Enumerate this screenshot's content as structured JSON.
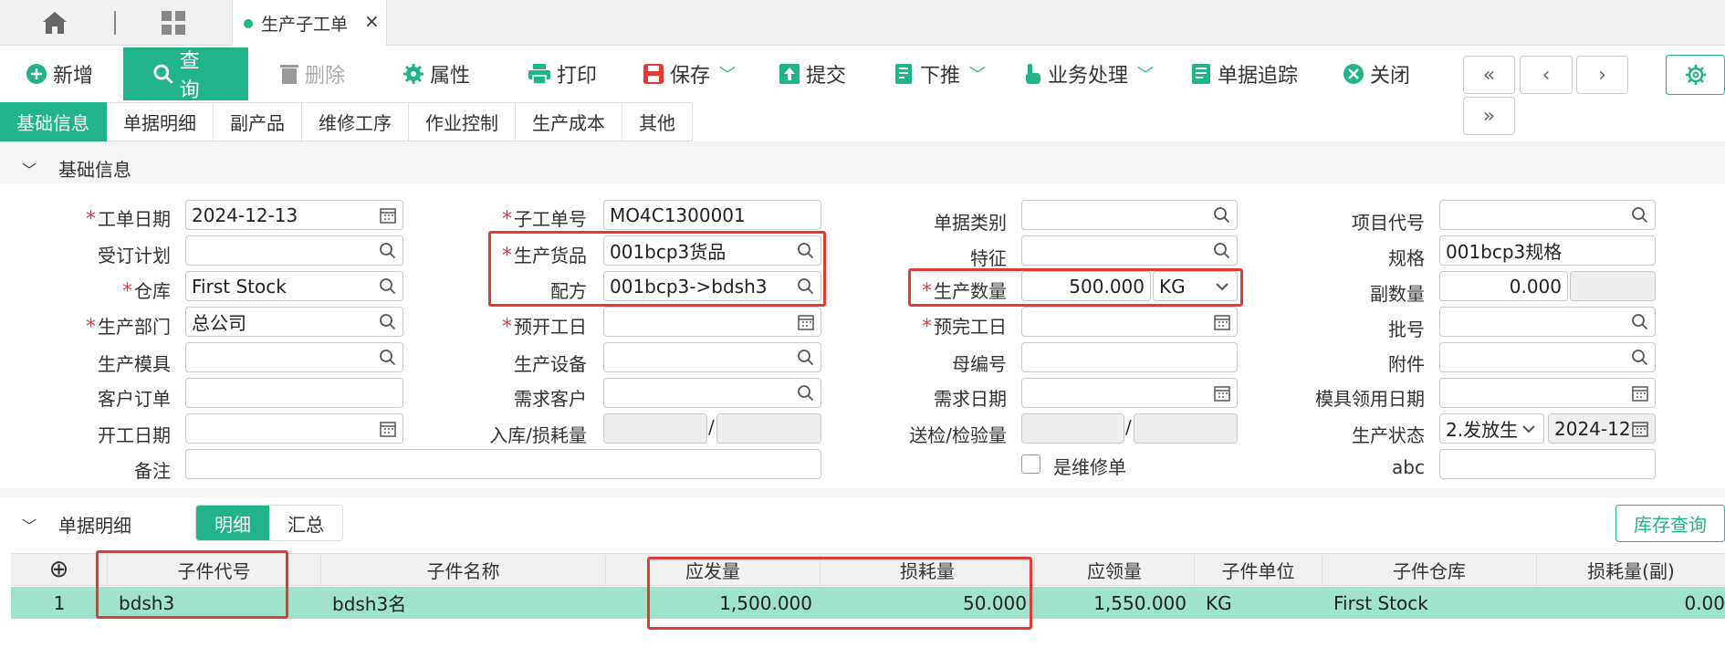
{
  "tabbar": {
    "active_tab": "生产子工单",
    "close": "×"
  },
  "toolbar": {
    "new": "新增",
    "query": "查询",
    "delete": "删除",
    "props": "属性",
    "print": "打印",
    "save": "保存",
    "submit": "提交",
    "push": "下推",
    "business": "业务处理",
    "trace": "单据追踪",
    "close": "关闭",
    "nav": [
      "«",
      "‹",
      "›",
      "»"
    ]
  },
  "section_tabs": [
    "基础信息",
    "单据明细",
    "副产品",
    "维修工序",
    "作业控制",
    "生产成本",
    "其他"
  ],
  "basic_section_title": "基础信息",
  "form": {
    "work_date": {
      "label": "工单日期",
      "value": "2024-12-13"
    },
    "order_plan": {
      "label": "受订计划",
      "value": ""
    },
    "warehouse": {
      "label": "仓库",
      "value": "First Stock"
    },
    "dept": {
      "label": "生产部门",
      "value": "总公司"
    },
    "mold": {
      "label": "生产模具",
      "value": ""
    },
    "cust_order": {
      "label": "客户订单",
      "value": ""
    },
    "open_date": {
      "label": "开工日期",
      "value": ""
    },
    "remark": {
      "label": "备注",
      "value": ""
    },
    "sub_no": {
      "label": "子工单号",
      "value": "MO4C1300001"
    },
    "goods": {
      "label": "生产货品",
      "value": "001bcp3货品"
    },
    "recipe": {
      "label": "配方",
      "value": "001bcp3->bdsh3"
    },
    "plan_open": {
      "label": "预开工日",
      "value": ""
    },
    "equip": {
      "label": "生产设备",
      "value": ""
    },
    "demand_cust": {
      "label": "需求客户",
      "value": ""
    },
    "in_loss": {
      "label": "入库/损耗量",
      "sep": "/"
    },
    "doc_type": {
      "label": "单据类别",
      "value": ""
    },
    "feature": {
      "label": "特征",
      "value": ""
    },
    "qty": {
      "label": "生产数量",
      "value": "500.000",
      "unit": "KG"
    },
    "plan_done": {
      "label": "预完工日",
      "value": ""
    },
    "parent_no": {
      "label": "母编号",
      "value": ""
    },
    "demand_date": {
      "label": "需求日期",
      "value": ""
    },
    "inspect": {
      "label": "送检/检验量",
      "sep": "/"
    },
    "repair": {
      "label": "是维修单"
    },
    "project": {
      "label": "项目代号",
      "value": ""
    },
    "spec": {
      "label": "规格",
      "value": "001bcp3规格"
    },
    "sub_qty": {
      "label": "副数量",
      "value": "0.000"
    },
    "batch": {
      "label": "批号",
      "value": ""
    },
    "attach": {
      "label": "附件",
      "value": ""
    },
    "mold_date": {
      "label": "模具领用日期",
      "value": ""
    },
    "status": {
      "label": "生产状态",
      "value": "2.发放生",
      "date": "2024-12"
    },
    "abc": {
      "label": "abc",
      "value": ""
    }
  },
  "detail": {
    "title": "单据明细",
    "tabs": [
      "明细",
      "汇总"
    ],
    "stock_query": "库存查询",
    "add": "⊕",
    "columns": [
      "子件代号",
      "子件名称",
      "应发量",
      "损耗量",
      "应领量",
      "子件单位",
      "子件仓库",
      "损耗量(副)"
    ],
    "rows": [
      {
        "no": "1",
        "code": "bdsh3",
        "name": "bdsh3名",
        "issue": "1,500.000",
        "loss": "50.000",
        "receive": "1,550.000",
        "unit": "KG",
        "wh": "First Stock",
        "loss2": "0.00"
      }
    ]
  },
  "colors": {
    "accent": "#21b38a",
    "highlight": "#e53935",
    "row": "#9fe3cc"
  }
}
